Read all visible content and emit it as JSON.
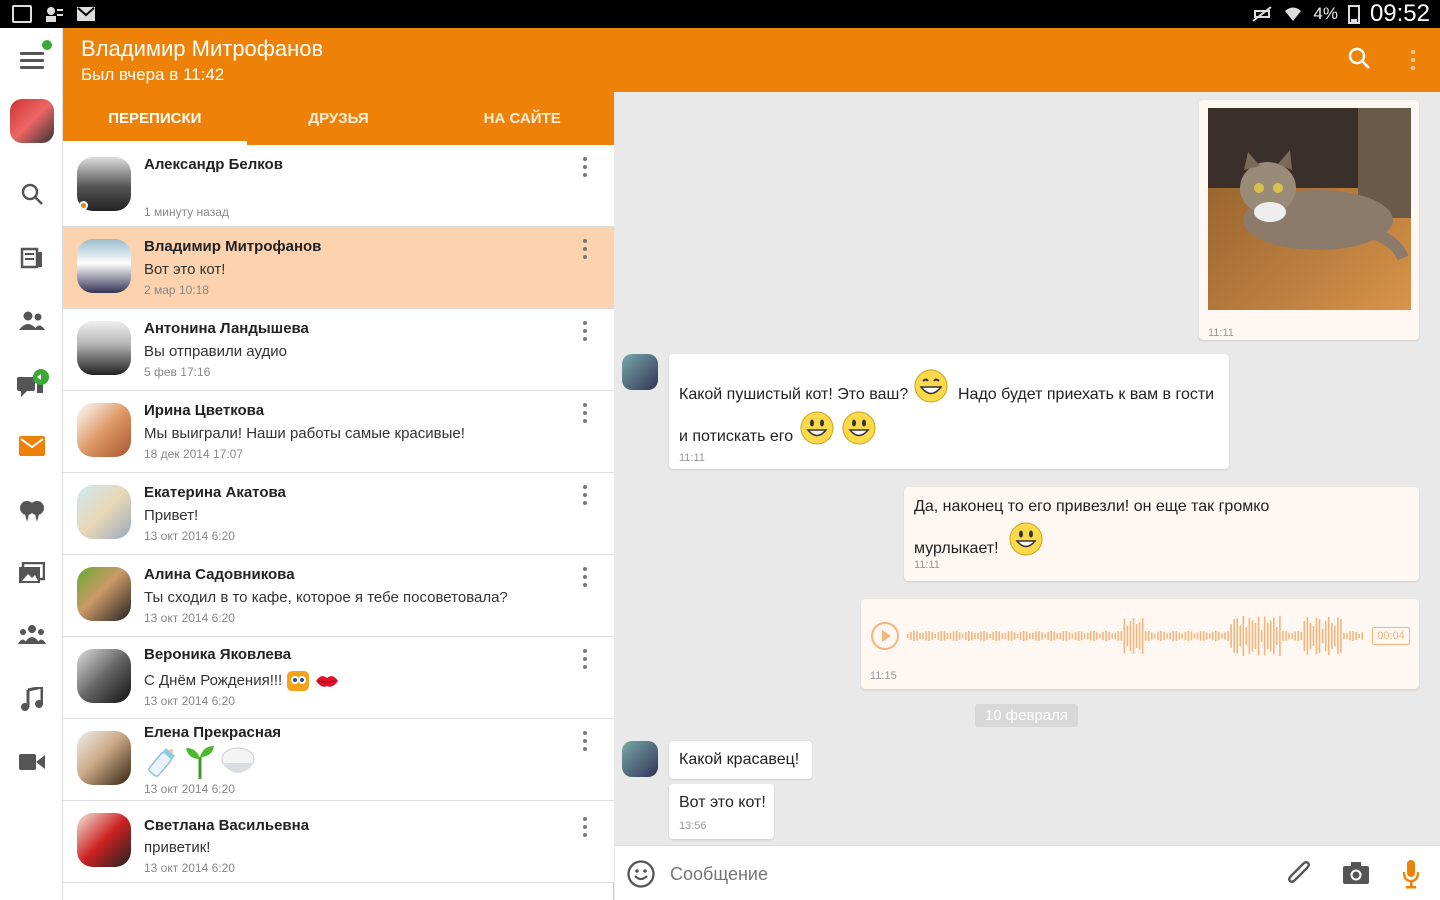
{
  "status_bar": {
    "battery": "4%",
    "clock": "09:52"
  },
  "header": {
    "contact_name": "Владимир Митрофанов",
    "last_seen": "Был вчера в 11:42"
  },
  "tabs": [
    {
      "label": "ПЕРЕПИСКИ",
      "active": true
    },
    {
      "label": "ДРУЗЬЯ",
      "active": false
    },
    {
      "label": "НА САЙТЕ",
      "active": false
    }
  ],
  "conversations": [
    {
      "name": "Александр Белков",
      "message": "",
      "time": "1 минуту назад",
      "online": true
    },
    {
      "name": "Владимир Митрофанов",
      "message": "Вот это кот!",
      "time": "2 мар 10:18",
      "selected": true
    },
    {
      "name": "Антонина Ландышева",
      "message": "Вы отправили аудио",
      "time": "5 фев 17:16"
    },
    {
      "name": "Ирина Цветкова",
      "message": "Мы выиграли! Наши работы самые красивые!",
      "time": "18 дек 2014 17:07"
    },
    {
      "name": "Екатерина Акатова",
      "message": "Привет!",
      "time": "13 окт 2014 6:20"
    },
    {
      "name": "Алина Садовникова",
      "message": "Ты сходил в то кафе, которое я тебе посоветовала?",
      "time": "13 окт 2014 6:20"
    },
    {
      "name": "Вероника Яковлева",
      "message": "С Днём Рождения!!!",
      "time": "13 окт 2014 6:20"
    },
    {
      "name": "Елена Прекрасная",
      "message": "",
      "time": "13 окт 2014 6:20"
    },
    {
      "name": "Светлана Васильевна",
      "message": "приветик!",
      "time": "13 окт 2014 6:20"
    }
  ],
  "chat": {
    "photo_time": "11:11",
    "msg1_line1": "Какой пушистый кот! Это ваш?",
    "msg1_line1b": "Надо будет приехать к вам в гости",
    "msg1_line2": "и потискать его",
    "msg1_time": "11:11",
    "msg2_line1": "Да, наконец то его привезли! он еще так громко",
    "msg2_line2": "мурлыкает!",
    "msg2_time": "11:11",
    "audio_duration": "00:04",
    "audio_time": "11:15",
    "date_separator": "10 февраля",
    "msg3": "Какой красавец!",
    "msg4": "Вот это кот!",
    "msg4_time": "13:56"
  },
  "input": {
    "placeholder": "Сообщение"
  },
  "colors": {
    "accent": "#ee8208",
    "selected_row": "#fcd3ae"
  }
}
